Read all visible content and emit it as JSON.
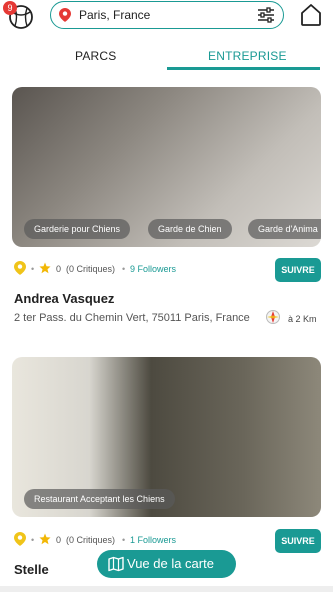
{
  "header": {
    "notification_count": "9",
    "search_value": "Paris, France"
  },
  "tabs": [
    {
      "label": "PARCS",
      "active": false
    },
    {
      "label": "ENTREPRISE",
      "active": true
    }
  ],
  "listings": [
    {
      "tags": [
        "Garderie pour Chiens",
        "Garde de Chien",
        "Garde d'Anima"
      ],
      "rating": "0",
      "critiques": "(0 Critiques)",
      "followers": "9 Followers",
      "follow_label": "SUIVRE",
      "name": "Andrea Vasquez",
      "address": "2 ter Pass. du Chemin Vert, 75011 Paris, France",
      "distance": "à 2 Km"
    },
    {
      "tags": [
        "Restaurant Acceptant les Chiens"
      ],
      "rating": "0",
      "critiques": "(0 Critiques)",
      "followers": "1 Followers",
      "follow_label": "SUIVRE",
      "name": "Stelle"
    }
  ],
  "map_button_label": "Vue de la carte",
  "colors": {
    "accent": "#1a9a94",
    "badge": "#e53935",
    "star": "#f2b705",
    "marker": "#f0c419"
  }
}
